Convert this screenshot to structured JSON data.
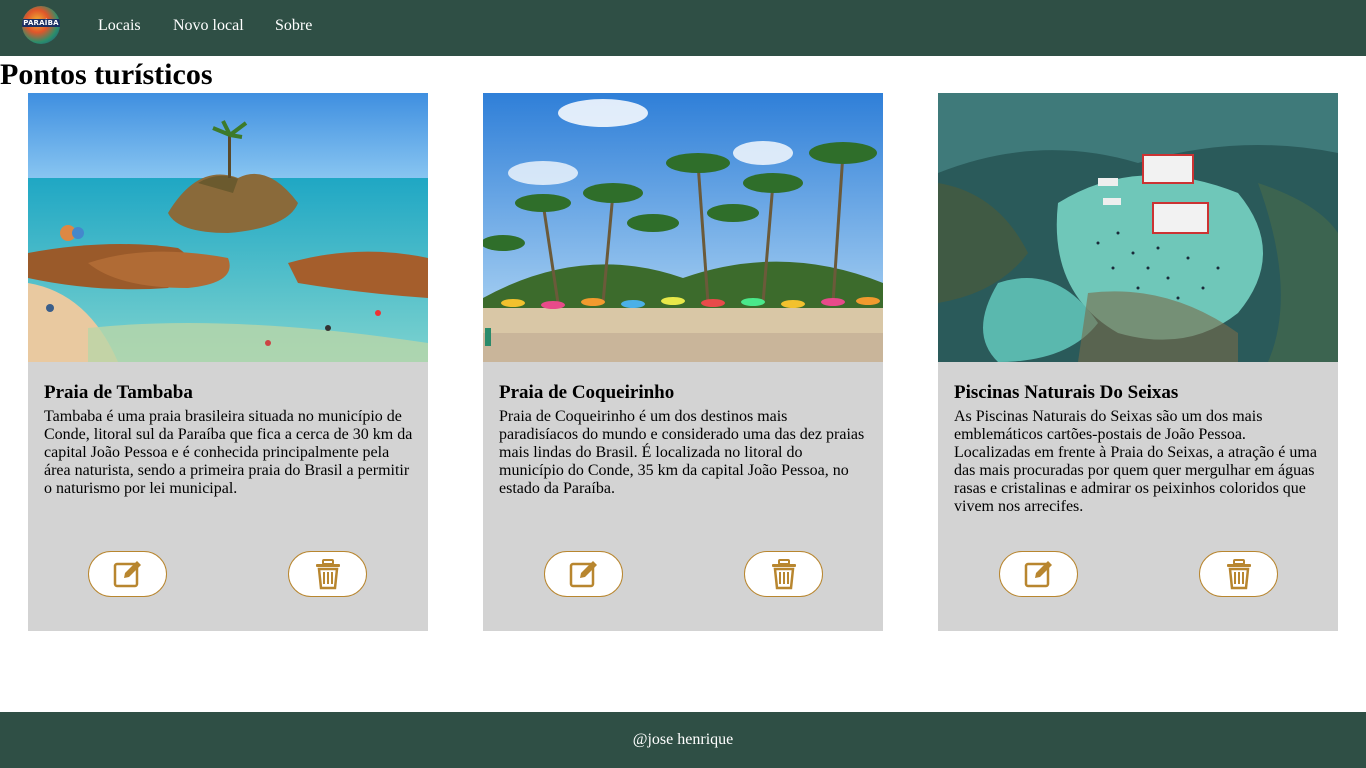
{
  "nav": {
    "logo_text": "PARAÍBA",
    "links": [
      "Locais",
      "Novo local",
      "Sobre"
    ]
  },
  "page": {
    "title": "Pontos turísticos"
  },
  "cards": [
    {
      "title": "Praia de Tambaba",
      "description": "Tambaba é uma praia brasileira situada no município de Conde, litoral sul da Paraíba que fica a cerca de 30 km da capital João Pessoa e é conhecida principalmente pela área naturista, sendo a primeira praia do Brasil a permitir o naturismo por lei municipal.",
      "edit_icon": "edit-icon",
      "delete_icon": "trash-icon"
    },
    {
      "title": "Praia de Coqueirinho",
      "description": "Praia de Coqueirinho é um dos destinos mais paradisíacos do mundo e considerado uma das dez praias mais lindas do Brasil. É localizada no litoral do município do Conde, 35 km da capital João Pessoa, no estado da Paraíba.",
      "edit_icon": "edit-icon",
      "delete_icon": "trash-icon"
    },
    {
      "title": "Piscinas Naturais Do Seixas",
      "description": "As Piscinas Naturais do Seixas são um dos mais emblemáticos cartões-postais de João Pessoa. Localizadas em frente à Praia do Seixas, a atração é uma das mais procuradas por quem quer mergulhar em águas rasas e cristalinas e admirar os peixinhos coloridos que vivem nos arrecifes.",
      "edit_icon": "edit-icon",
      "delete_icon": "trash-icon"
    }
  ],
  "footer": {
    "text": "@jose henrique"
  },
  "colors": {
    "nav_bg": "#2f4f45",
    "card_bg": "#d3d3d3",
    "accent": "#b8862f"
  }
}
